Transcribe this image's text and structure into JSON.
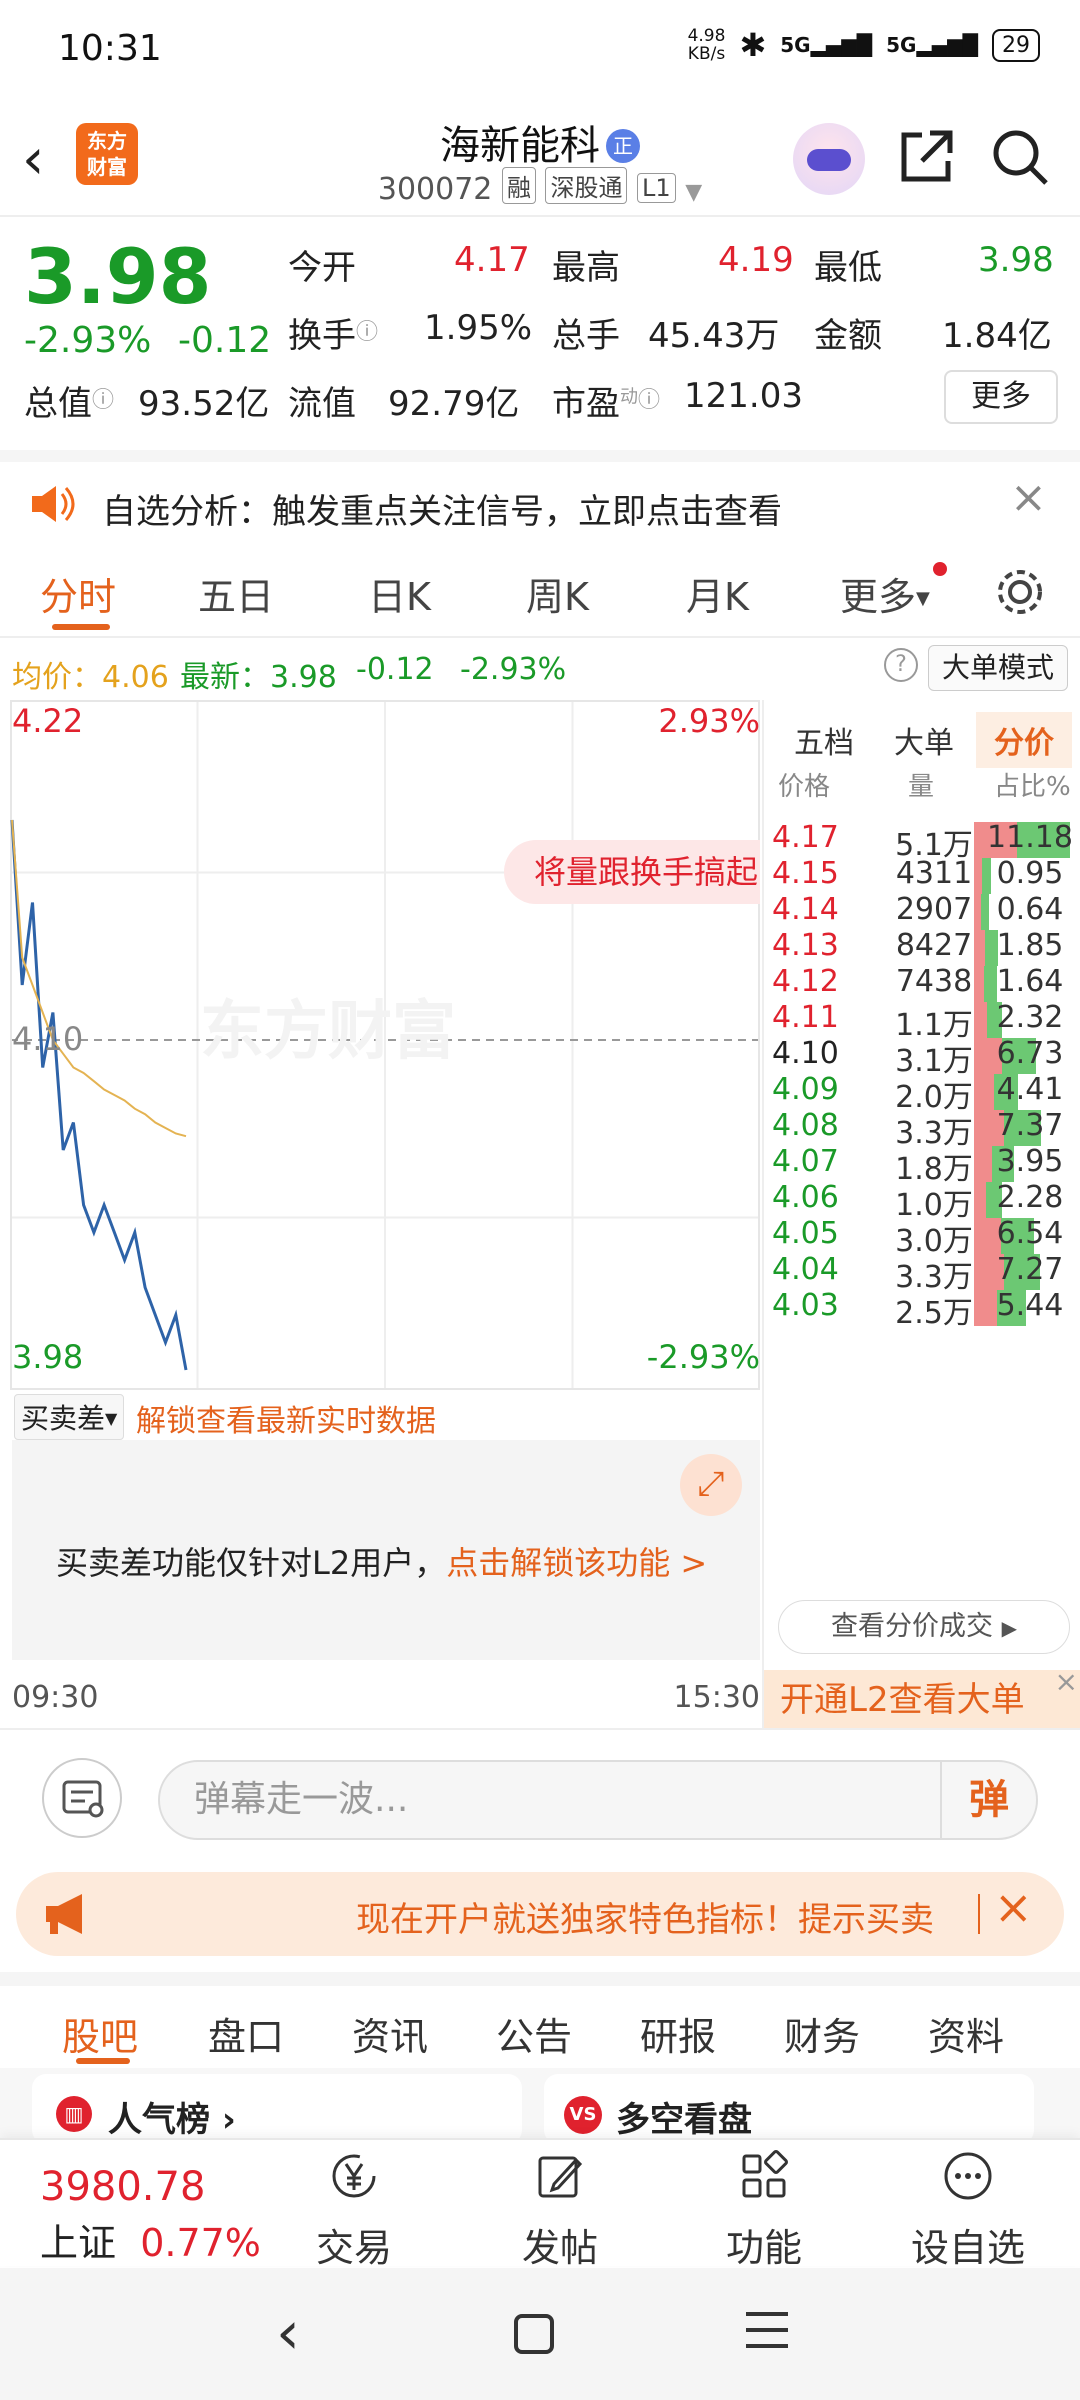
{
  "status_bar": {
    "time": "10:31",
    "net_speed": "4.98\nKB/s",
    "net1": "5G",
    "net2": "5G",
    "battery": "29"
  },
  "header": {
    "logo_line1": "东方",
    "logo_line2": "财富",
    "stock_name": "海新能科",
    "verified": "正",
    "code": "300072",
    "tag1": "融",
    "tag2": "深股通",
    "tag3": "L1"
  },
  "quote": {
    "price": "3.98",
    "change_pct": "-2.93%",
    "change": "-0.12",
    "open_label": "今开",
    "open": "4.17",
    "high_label": "最高",
    "high": "4.19",
    "low_label": "最低",
    "low": "3.98",
    "turnover_label": "换手",
    "turnover": "1.95%",
    "volume_label": "总手",
    "volume": "45.43万",
    "amount_label": "金额",
    "amount": "1.84亿",
    "mktcap_label": "总值",
    "mktcap": "93.52亿",
    "float_label": "流值",
    "float": "92.79亿",
    "pe_label": "市盈",
    "pe_sup": "动",
    "pe": "121.03",
    "more": "更多"
  },
  "notice": {
    "text": "自选分析：触发重点关注信号，立即点击查看"
  },
  "chart_tabs": [
    "分时",
    "五日",
    "日K",
    "周K",
    "月K",
    "更多"
  ],
  "info_row": {
    "avg_label": "均价：",
    "avg": "4.06",
    "latest_label": "最新：",
    "latest": "3.98",
    "chg": "-0.12",
    "pct": "-2.93%",
    "mode": "大单模式"
  },
  "chart": {
    "top_price": "4.22",
    "top_pct": "2.93%",
    "mid_price": "4.10",
    "bottom_price": "3.98",
    "bottom_pct": "-2.93%",
    "watermark": "东方财富",
    "bubble": "将量跟换手搞起",
    "start_time": "09:30",
    "end_time": "15:30"
  },
  "chart_data": {
    "type": "line",
    "ylim": [
      3.98,
      4.22
    ],
    "series": [
      {
        "name": "最新",
        "values": [
          4.18,
          4.12,
          4.15,
          4.09,
          4.11,
          4.06,
          4.07,
          4.04,
          4.03,
          4.04,
          4.03,
          4.02,
          4.03,
          4.01,
          4.0,
          3.99,
          4.0,
          3.98
        ]
      },
      {
        "name": "均价",
        "values": [
          4.18,
          4.13,
          4.12,
          4.11,
          4.1,
          4.095,
          4.09,
          4.088,
          4.085,
          4.082,
          4.08,
          4.078,
          4.075,
          4.073,
          4.07,
          4.068,
          4.066,
          4.065
        ]
      }
    ]
  },
  "sell_diff": {
    "label": "买卖差",
    "unlock": "解锁查看最新实时数据",
    "l2_text": "买卖差功能仅针对L2用户，",
    "l2_link": "点击解锁该功能 >"
  },
  "right_panel": {
    "tabs": [
      "五档",
      "大单",
      "分价"
    ],
    "headers": [
      "价格",
      "量",
      "占比%"
    ],
    "rows": [
      {
        "price": "4.17",
        "vol": "5.1万",
        "pct": "11.18",
        "pct_value": 11.18,
        "color": "#e0222e"
      },
      {
        "price": "4.15",
        "vol": "4311",
        "pct": "0.95",
        "pct_value": 0.95,
        "color": "#e0222e"
      },
      {
        "price": "4.14",
        "vol": "2907",
        "pct": "0.64",
        "pct_value": 0.64,
        "color": "#e0222e"
      },
      {
        "price": "4.13",
        "vol": "8427",
        "pct": "1.85",
        "pct_value": 1.85,
        "color": "#e0222e"
      },
      {
        "price": "4.12",
        "vol": "7438",
        "pct": "1.64",
        "pct_value": 1.64,
        "color": "#e0222e"
      },
      {
        "price": "4.11",
        "vol": "1.1万",
        "pct": "2.32",
        "pct_value": 2.32,
        "color": "#e0222e"
      },
      {
        "price": "4.10",
        "vol": "3.1万",
        "pct": "6.73",
        "pct_value": 6.73,
        "color": "#222222"
      },
      {
        "price": "4.09",
        "vol": "2.0万",
        "pct": "4.41",
        "pct_value": 4.41,
        "color": "#1a9a28"
      },
      {
        "price": "4.08",
        "vol": "3.3万",
        "pct": "7.37",
        "pct_value": 7.37,
        "color": "#1a9a28"
      },
      {
        "price": "4.07",
        "vol": "1.8万",
        "pct": "3.95",
        "pct_value": 3.95,
        "color": "#1a9a28"
      },
      {
        "price": "4.06",
        "vol": "1.0万",
        "pct": "2.28",
        "pct_value": 2.28,
        "color": "#1a9a28"
      },
      {
        "price": "4.05",
        "vol": "3.0万",
        "pct": "6.54",
        "pct_value": 6.54,
        "color": "#1a9a28"
      },
      {
        "price": "4.04",
        "vol": "3.3万",
        "pct": "7.27",
        "pct_value": 7.27,
        "color": "#1a9a28"
      },
      {
        "price": "4.03",
        "vol": "2.5万",
        "pct": "5.44",
        "pct_value": 5.44,
        "color": "#1a9a28"
      }
    ],
    "see_deal": "查看分价成交",
    "l2_banner": "开通L2查看大单"
  },
  "danmu": {
    "placeholder": "弹幕走一波...",
    "btn": "弹"
  },
  "promo": {
    "text": "现在开户就送独家特色指标！提示买卖"
  },
  "bottom_tabs": [
    "股吧",
    "盘口",
    "资讯",
    "公告",
    "研报",
    "财务",
    "资料"
  ],
  "cards": [
    "人气榜",
    "多空看盘"
  ],
  "nav": {
    "index_value": "3980.78",
    "index_name": "上证",
    "index_pct": "0.77%",
    "trade": "交易",
    "post": "发帖",
    "func": "功能",
    "watch": "设自选"
  },
  "colors": {
    "accent": "#e4621d",
    "up": "#e0222e",
    "down": "#1a9a28"
  }
}
